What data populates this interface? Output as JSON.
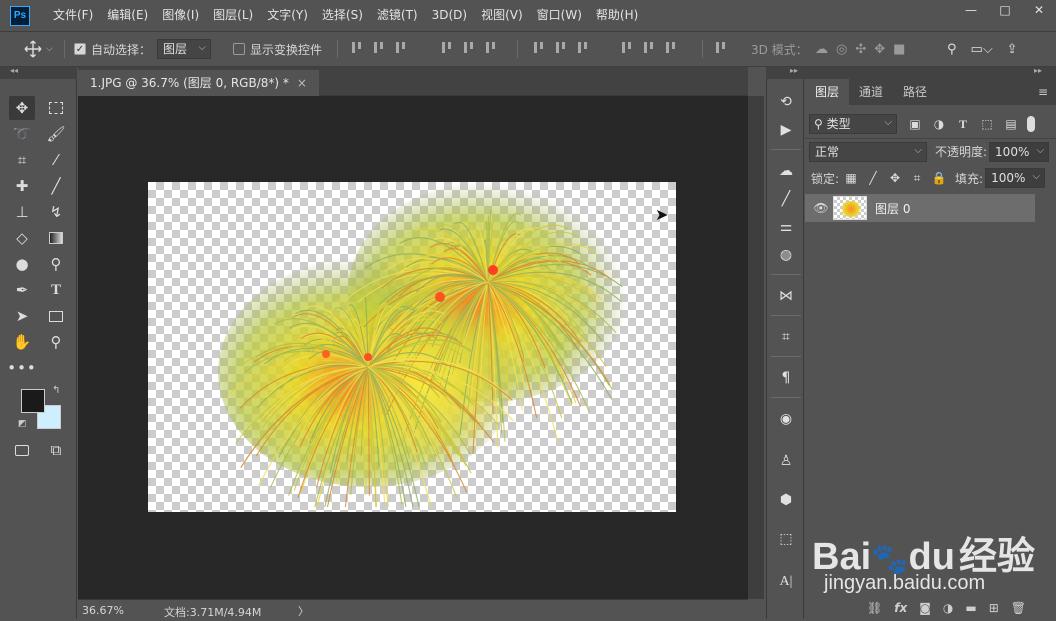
{
  "app": {
    "logo": "Ps"
  },
  "menu": [
    "文件(F)",
    "编辑(E)",
    "图像(I)",
    "图层(L)",
    "文字(Y)",
    "选择(S)",
    "滤镜(T)",
    "3D(D)",
    "视图(V)",
    "窗口(W)",
    "帮助(H)"
  ],
  "window_controls": {
    "minimize": "—",
    "restore": "□",
    "close": "✕"
  },
  "options": {
    "auto_select_label": "自动选择：",
    "auto_select_checked": true,
    "auto_select_value": "图层",
    "show_transform_label": "显示变换控件",
    "mode_3d_label": "3D 模式："
  },
  "document": {
    "tab_title": "1.JPG @ 36.7% (图层 0, RGB/8*) *",
    "close": "×"
  },
  "status": {
    "zoom": "36.67%",
    "doc": "文档:3.71M/4.94M",
    "arrow": "〉"
  },
  "panel": {
    "tabs": [
      "图层",
      "通道",
      "路径"
    ],
    "filter_kind": "类型",
    "blend_mode": "正常",
    "opacity_label": "不透明度:",
    "opacity_value": "100%",
    "lock_label": "锁定:",
    "fill_label": "填充:",
    "fill_value": "100%",
    "layer_name": "图层 0",
    "footer_icons": [
      "link-icon",
      "fx-icon",
      "mask-icon",
      "adjustment-icon",
      "folder-icon",
      "new-layer-icon",
      "trash-icon"
    ],
    "fx_label": "fx"
  },
  "watermark": {
    "brand": "Bai",
    "brand_du": "du",
    "brand_cn": "经验",
    "url": "jingyan.baidu.com"
  },
  "colors": {
    "foreground": "#1a1a1a",
    "background": "#cfeeff",
    "accent": "#31a8ff"
  }
}
